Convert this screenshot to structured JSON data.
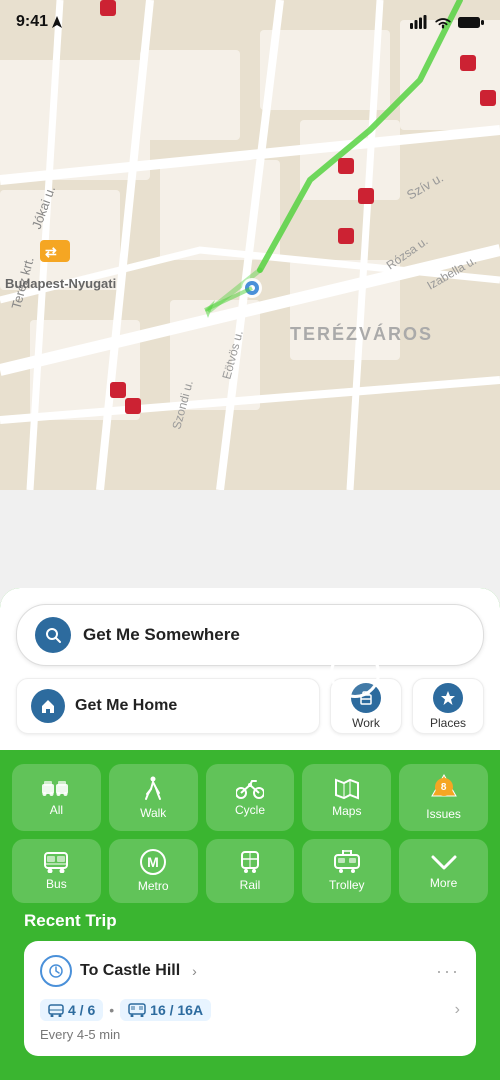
{
  "statusBar": {
    "time": "9:41",
    "signalIcon": "signal-icon",
    "wifiIcon": "wifi-icon",
    "batteryIcon": "battery-icon"
  },
  "map": {
    "district": "TERÉZVÁROS",
    "landmark": "Budapest-Nyugati"
  },
  "search": {
    "placeholder": "Get Me Somewhere",
    "homeLabel": "Get Me Home",
    "workLabel": "Work",
    "placesLabel": "Places"
  },
  "transport": {
    "items": [
      {
        "id": "all",
        "label": "All",
        "icon": "transit-icon"
      },
      {
        "id": "walk",
        "label": "Walk",
        "icon": "walk-icon"
      },
      {
        "id": "cycle",
        "label": "Cycle",
        "icon": "cycle-icon"
      },
      {
        "id": "maps",
        "label": "Maps",
        "icon": "maps-icon"
      },
      {
        "id": "issues",
        "label": "Issues",
        "icon": "issues-icon",
        "badge": "8"
      },
      {
        "id": "bus",
        "label": "Bus",
        "icon": "bus-icon"
      },
      {
        "id": "metro",
        "label": "Metro",
        "icon": "metro-icon"
      },
      {
        "id": "rail",
        "label": "Rail",
        "icon": "rail-icon"
      },
      {
        "id": "trolley",
        "label": "Trolley",
        "icon": "trolley-icon"
      },
      {
        "id": "more",
        "label": "More",
        "icon": "more-icon"
      }
    ]
  },
  "recentTrip": {
    "sectionTitle": "Recent Trip",
    "destination": "To Castle Hill",
    "routes": [
      {
        "icon": "tram-icon",
        "numbers": "4 / 6"
      },
      {
        "icon": "bus-icon",
        "numbers": "16 / 16A"
      }
    ],
    "frequency": "Every 4-5 min"
  }
}
